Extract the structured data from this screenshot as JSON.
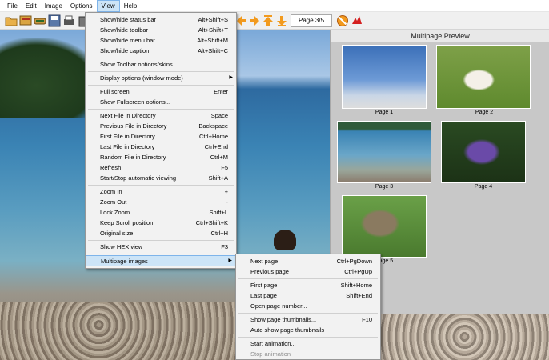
{
  "menubar": {
    "items": [
      {
        "label": "File"
      },
      {
        "label": "Edit"
      },
      {
        "label": "Image"
      },
      {
        "label": "Options"
      },
      {
        "label": "View"
      },
      {
        "label": "Help"
      }
    ]
  },
  "toolbar": {
    "page_indicator": "Page 3/5",
    "icons": [
      "open-folder-icon",
      "thumbnails-icon",
      "scan-icon",
      "save-icon",
      "print-icon",
      "delete-icon",
      "arrow-left-icon",
      "arrow-right-icon",
      "arrow-first-icon",
      "arrow-down-icon",
      "no-entry-icon",
      "irfanview-logo-icon"
    ]
  },
  "view_menu": {
    "items": [
      {
        "label": "Show/hide status bar",
        "shortcut": "Alt+Shift+S"
      },
      {
        "label": "Show/hide toolbar",
        "shortcut": "Alt+Shift+T"
      },
      {
        "label": "Show/hide menu bar",
        "shortcut": "Alt+Shift+M"
      },
      {
        "label": "Show/hide caption",
        "shortcut": "Alt+Shift+C"
      },
      {
        "label": "Show Toolbar options/skins...",
        "shortcut": ""
      },
      {
        "label": "Display options (window mode)",
        "shortcut": ""
      },
      {
        "label": "Full screen",
        "shortcut": "Enter"
      },
      {
        "label": "Show Fullscreen options...",
        "shortcut": ""
      },
      {
        "label": "Next File in Directory",
        "shortcut": "Space"
      },
      {
        "label": "Previous File in Directory",
        "shortcut": "Backspace"
      },
      {
        "label": "First File in Directory",
        "shortcut": "Ctrl+Home"
      },
      {
        "label": "Last File in Directory",
        "shortcut": "Ctrl+End"
      },
      {
        "label": "Random File in Directory",
        "shortcut": "Ctrl+M"
      },
      {
        "label": "Refresh",
        "shortcut": "F5"
      },
      {
        "label": "Start/Stop automatic viewing",
        "shortcut": "Shift+A"
      },
      {
        "label": "Zoom In",
        "shortcut": "+"
      },
      {
        "label": "Zoom Out",
        "shortcut": "-"
      },
      {
        "label": "Lock Zoom",
        "shortcut": "Shift+L"
      },
      {
        "label": "Keep Scroll position",
        "shortcut": "Ctrl+Shift+K"
      },
      {
        "label": "Original size",
        "shortcut": "Ctrl+H"
      },
      {
        "label": "Show HEX view",
        "shortcut": "F3"
      },
      {
        "label": "Multipage images",
        "shortcut": ""
      }
    ]
  },
  "multipage_menu": {
    "items": [
      {
        "label": "Next page",
        "shortcut": "Ctrl+PgDown"
      },
      {
        "label": "Previous page",
        "shortcut": "Ctrl+PgUp"
      },
      {
        "label": "First page",
        "shortcut": "Shift+Home"
      },
      {
        "label": "Last page",
        "shortcut": "Shift+End"
      },
      {
        "label": "Open page number...",
        "shortcut": ""
      },
      {
        "label": "Show page thumbnails...",
        "shortcut": "F10"
      },
      {
        "label": "Auto show page thumbnails",
        "shortcut": ""
      },
      {
        "label": "Start animation...",
        "shortcut": ""
      },
      {
        "label": "Stop animation",
        "shortcut": ""
      }
    ]
  },
  "preview_panel": {
    "title": "Multipage Preview",
    "pages": [
      {
        "caption": "Page 1"
      },
      {
        "caption": "Page 2"
      },
      {
        "caption": "Page 3"
      },
      {
        "caption": "Page 4"
      },
      {
        "caption": "Page 5"
      }
    ]
  },
  "colors": {
    "highlight": "#cce4f7",
    "highlight_border": "#7eb4ea",
    "menu_bg": "#f2f2f2",
    "panel_bg": "#c8c8c8"
  }
}
